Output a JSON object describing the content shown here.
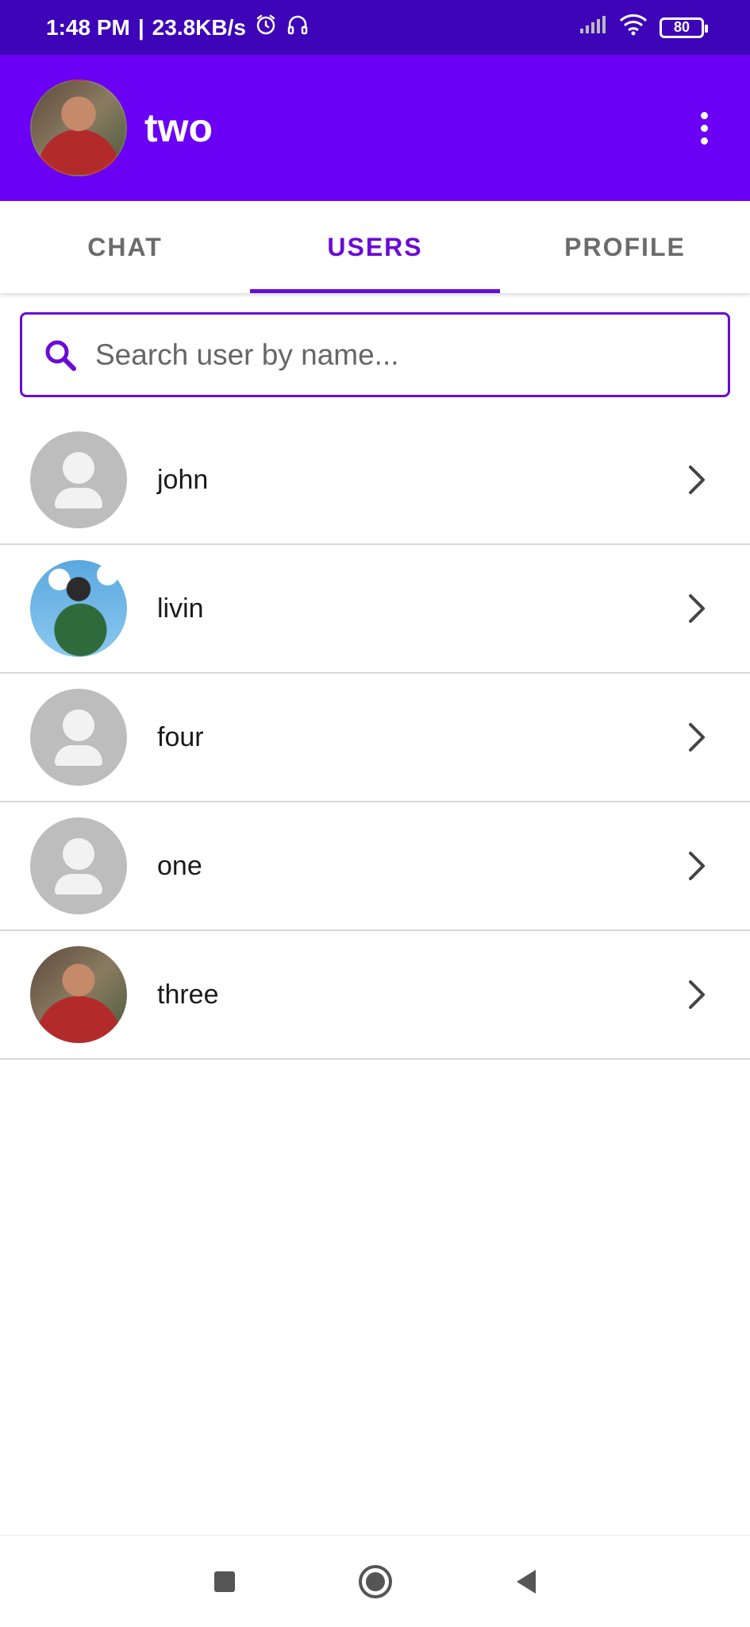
{
  "status_bar": {
    "time": "1:48 PM",
    "separator": "|",
    "speed": "23.8KB/s",
    "battery": "80"
  },
  "app_bar": {
    "title": "two"
  },
  "tabs": [
    {
      "label": "CHAT",
      "active": false
    },
    {
      "label": "USERS",
      "active": true
    },
    {
      "label": "PROFILE",
      "active": false
    }
  ],
  "search": {
    "placeholder": "Search user by name..."
  },
  "users": [
    {
      "name": "john",
      "avatar": "default"
    },
    {
      "name": "livin",
      "avatar": "photo-anime"
    },
    {
      "name": "four",
      "avatar": "default"
    },
    {
      "name": "one",
      "avatar": "default"
    },
    {
      "name": "three",
      "avatar": "photo-man"
    }
  ],
  "colors": {
    "status_bar": "#3d04b8",
    "app_bar": "#6a00f4",
    "accent": "#6a0ad8"
  },
  "icons": {
    "search": "search-icon",
    "chevron": "chevron-right-icon",
    "overflow": "more-vert-icon",
    "nav_recent": "square-icon",
    "nav_home": "circle-icon",
    "nav_back": "triangle-back-icon"
  }
}
